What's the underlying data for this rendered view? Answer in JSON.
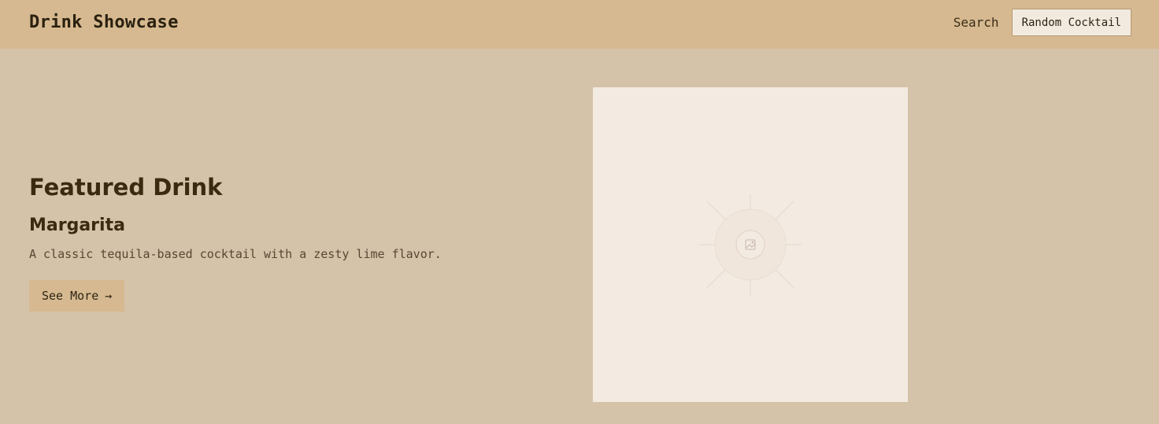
{
  "header": {
    "brand": "Drink Showcase",
    "nav": {
      "search_label": "Search",
      "random_label": "Random Cocktail"
    }
  },
  "featured": {
    "section_title": "Featured Drink",
    "drink_name": "Margarita",
    "description": "A classic tequila-based cocktail with a zesty lime flavor.",
    "cta_label": "See More",
    "cta_icon": "arrow-right-icon",
    "image_icon": "image-placeholder-icon"
  },
  "colors": {
    "page_bg": "#d4c2a9",
    "header_bg": "#d6b990",
    "button_bg": "#d6b990",
    "text_dark": "#3a2a10",
    "image_bg": "#f3ebe1"
  }
}
